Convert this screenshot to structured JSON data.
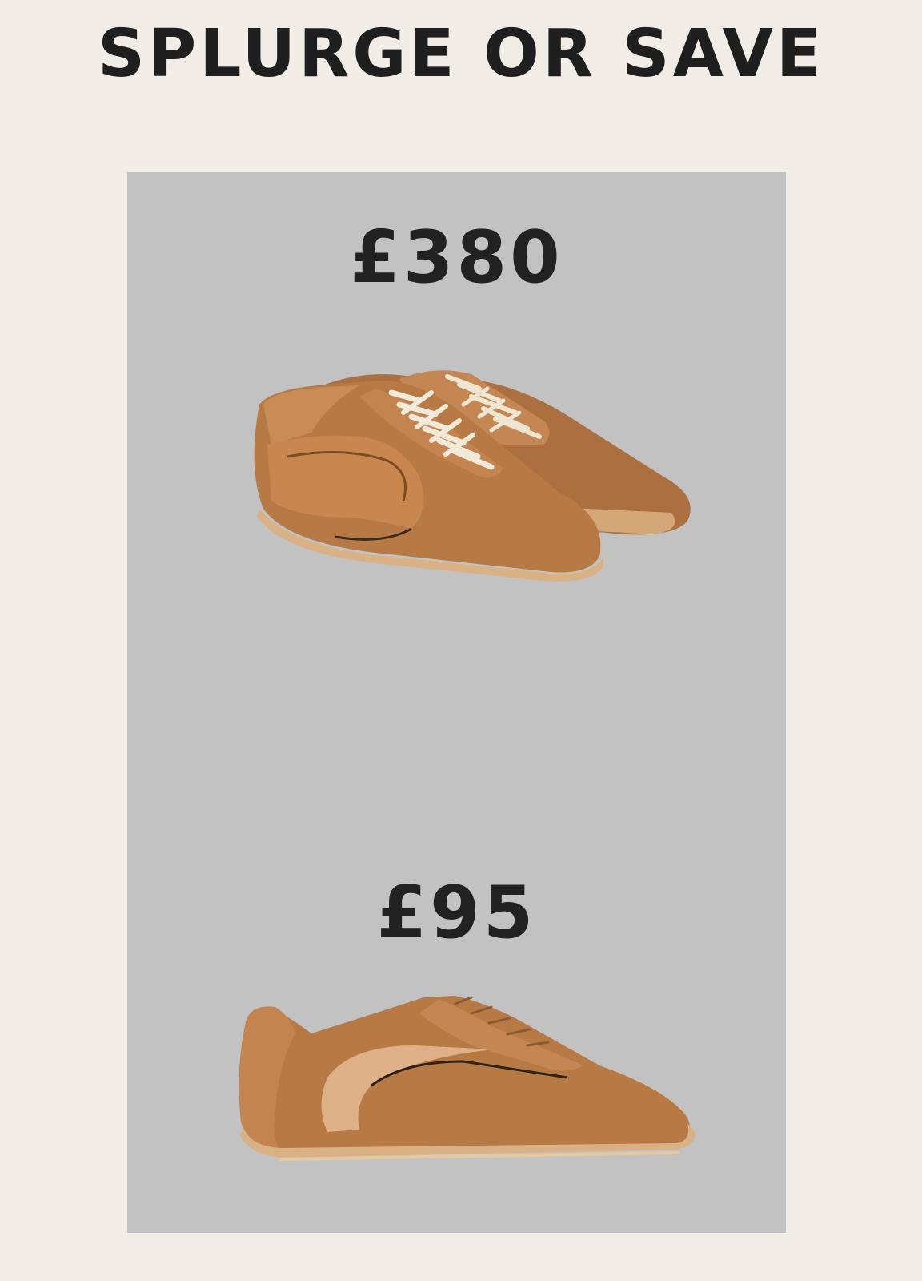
{
  "header": {
    "title": "SPLURGE OR SAVE"
  },
  "products": [
    {
      "price": "£380",
      "image_icon": "suede-sneaker-pair-icon"
    },
    {
      "price": "£95",
      "image_icon": "suede-sneaker-side-icon"
    }
  ],
  "colors": {
    "background": "#f1ede6",
    "panel": "#c2c2c2",
    "text": "#1f1f1f",
    "suede": "#b87a45",
    "leather": "#c48450",
    "sole": "#d9b185",
    "laces": "#f1ead8"
  }
}
